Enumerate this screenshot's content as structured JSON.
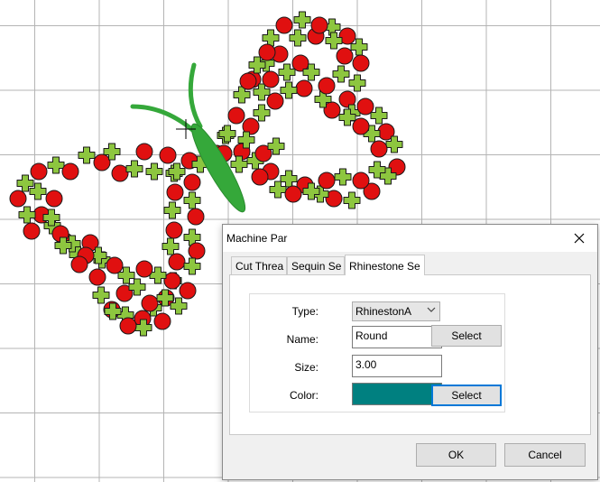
{
  "canvas": {
    "grid_color": "#b4b4b4",
    "butterfly": {
      "rhinestone_color": "#e01010",
      "sequin_color": "#8dc63f",
      "body_color": "#35a83a",
      "outline_color": "#1a1a1a"
    }
  },
  "dialog": {
    "title": "Machine Par",
    "close_icon": "close-icon",
    "tabs": [
      {
        "label": "Cut Threa",
        "active": false
      },
      {
        "label": "Sequin Se",
        "active": false
      },
      {
        "label": "Rhinestone Se",
        "active": true
      }
    ],
    "form": {
      "type_label": "Type:",
      "type_value": "RhinestonA",
      "name_label": "Name:",
      "name_value": "Round",
      "size_label": "Size:",
      "size_value": "3.00",
      "color_label": "Color:",
      "color_value": "#008080",
      "select_label": "Select",
      "select_color_label": "Select"
    },
    "buttons": {
      "ok": "OK",
      "cancel": "Cancel"
    }
  }
}
